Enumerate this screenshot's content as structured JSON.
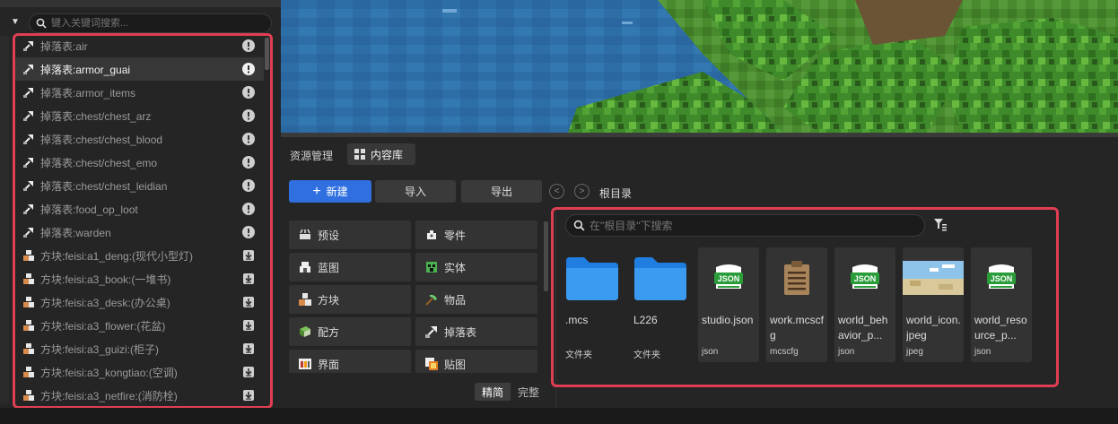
{
  "left_panel": {
    "search_placeholder": "键入关键词搜索...",
    "items": [
      {
        "label": "掉落表:air",
        "icon": "loot-table-icon",
        "badge": "info-icon"
      },
      {
        "label": "掉落表:armor_guai",
        "icon": "loot-table-icon",
        "badge": "info-icon",
        "selected": true
      },
      {
        "label": "掉落表:armor_items",
        "icon": "loot-table-icon",
        "badge": "info-icon"
      },
      {
        "label": "掉落表:chest/chest_arz",
        "icon": "loot-table-icon",
        "badge": "info-icon"
      },
      {
        "label": "掉落表:chest/chest_blood",
        "icon": "loot-table-icon",
        "badge": "info-icon"
      },
      {
        "label": "掉落表:chest/chest_emo",
        "icon": "loot-table-icon",
        "badge": "info-icon"
      },
      {
        "label": "掉落表:chest/chest_leidian",
        "icon": "loot-table-icon",
        "badge": "info-icon"
      },
      {
        "label": "掉落表:food_op_loot",
        "icon": "loot-table-icon",
        "badge": "info-icon"
      },
      {
        "label": "掉落表:warden",
        "icon": "loot-table-icon",
        "badge": "info-icon"
      },
      {
        "label": "方块:feisi:a1_deng:(现代小型灯)",
        "icon": "block-icon",
        "badge": "download-icon"
      },
      {
        "label": "方块:feisi:a3_book:(一堆书)",
        "icon": "block-icon",
        "badge": "download-icon"
      },
      {
        "label": "方块:feisi:a3_desk:(办公桌)",
        "icon": "block-icon",
        "badge": "download-icon"
      },
      {
        "label": "方块:feisi:a3_flower:(花盆)",
        "icon": "block-icon",
        "badge": "download-icon"
      },
      {
        "label": "方块:feisi:a3_guizi:(柜子)",
        "icon": "block-icon",
        "badge": "download-icon"
      },
      {
        "label": "方块:feisi:a3_kongtiao:(空调)",
        "icon": "block-icon",
        "badge": "download-icon"
      },
      {
        "label": "方块:feisi:a3_netfire:(消防栓)",
        "icon": "block-icon",
        "badge": "download-icon"
      }
    ]
  },
  "resource_panel": {
    "tab_label": "资源管理",
    "active_tab": "内容库",
    "new_button": "新建",
    "import_button": "导入",
    "export_button": "导出",
    "breadcrumb": "根目录",
    "categories": [
      {
        "label": "预设",
        "icon": "preset-icon"
      },
      {
        "label": "零件",
        "icon": "part-icon"
      },
      {
        "label": "蓝图",
        "icon": "blueprint-icon"
      },
      {
        "label": "实体",
        "icon": "entity-icon"
      },
      {
        "label": "方块",
        "icon": "block-icon"
      },
      {
        "label": "物品",
        "icon": "item-icon"
      },
      {
        "label": "配方",
        "icon": "recipe-icon"
      },
      {
        "label": "掉落表",
        "icon": "loot-table-icon"
      },
      {
        "label": "界面",
        "icon": "ui-icon"
      },
      {
        "label": "贴图",
        "icon": "texture-icon"
      }
    ],
    "mode_simple": "精简",
    "mode_full": "完整",
    "file_search_placeholder": "在\"根目录\"下搜索",
    "files": [
      {
        "name": ".mcs",
        "type": "文件夹",
        "icon": "folder-icon"
      },
      {
        "name": "L226",
        "type": "文件夹",
        "icon": "folder-icon"
      },
      {
        "name": "studio.json",
        "type": "json",
        "icon": "json-file-icon"
      },
      {
        "name": "work.mcscfg",
        "type": "mcscfg",
        "icon": "clipboard-file-icon"
      },
      {
        "name": "world_behavior_p...",
        "type": "json",
        "icon": "json-file-icon"
      },
      {
        "name": "world_icon.jpeg",
        "type": "jpeg",
        "icon": "image-thumbnail"
      },
      {
        "name": "world_resource_p...",
        "type": "json",
        "icon": "json-file-icon"
      }
    ]
  },
  "colors": {
    "accent_blue": "#2f6fe0",
    "highlight_red": "#e03e52",
    "json_green": "#2a9d3a"
  }
}
